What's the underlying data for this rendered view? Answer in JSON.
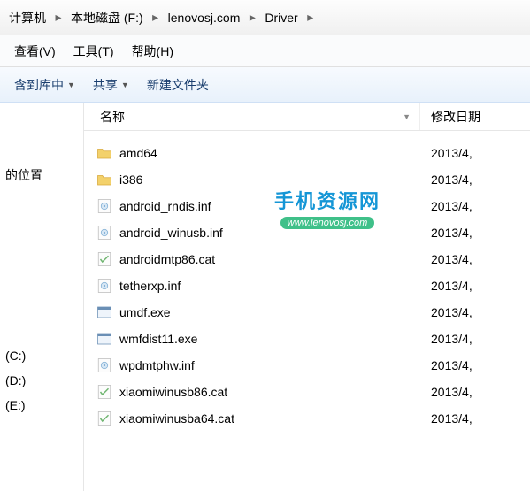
{
  "breadcrumb": {
    "items": [
      {
        "label": "计算机"
      },
      {
        "label": "本地磁盘 (F:)"
      },
      {
        "label": "lenovosj.com"
      },
      {
        "label": "Driver"
      }
    ]
  },
  "menubar": {
    "view": "查看(V)",
    "tools": "工具(T)",
    "help": "帮助(H)"
  },
  "toolbar": {
    "add_library": "含到库中",
    "share": "共享",
    "new_folder": "新建文件夹"
  },
  "sidebar": {
    "location_label": "的位置",
    "drives": [
      {
        "label": "(C:)"
      },
      {
        "label": "(D:)"
      },
      {
        "label": "(E:)"
      }
    ]
  },
  "columns": {
    "name": "名称",
    "date": "修改日期"
  },
  "files": [
    {
      "icon": "folder",
      "name": "amd64",
      "date": "2013/4,"
    },
    {
      "icon": "folder",
      "name": "i386",
      "date": "2013/4,"
    },
    {
      "icon": "inf",
      "name": "android_rndis.inf",
      "date": "2013/4,"
    },
    {
      "icon": "inf",
      "name": "android_winusb.inf",
      "date": "2013/4,"
    },
    {
      "icon": "cat",
      "name": "androidmtp86.cat",
      "date": "2013/4,"
    },
    {
      "icon": "inf",
      "name": "tetherxp.inf",
      "date": "2013/4,"
    },
    {
      "icon": "exe",
      "name": "umdf.exe",
      "date": "2013/4,"
    },
    {
      "icon": "exe",
      "name": "wmfdist11.exe",
      "date": "2013/4,"
    },
    {
      "icon": "inf",
      "name": "wpdmtphw.inf",
      "date": "2013/4,"
    },
    {
      "icon": "cat",
      "name": "xiaomiwinusb86.cat",
      "date": "2013/4,"
    },
    {
      "icon": "cat",
      "name": "xiaomiwinusba64.cat",
      "date": "2013/4,"
    }
  ],
  "watermark": {
    "main": "手机资源网",
    "sub": "www.lenovosj.com"
  }
}
